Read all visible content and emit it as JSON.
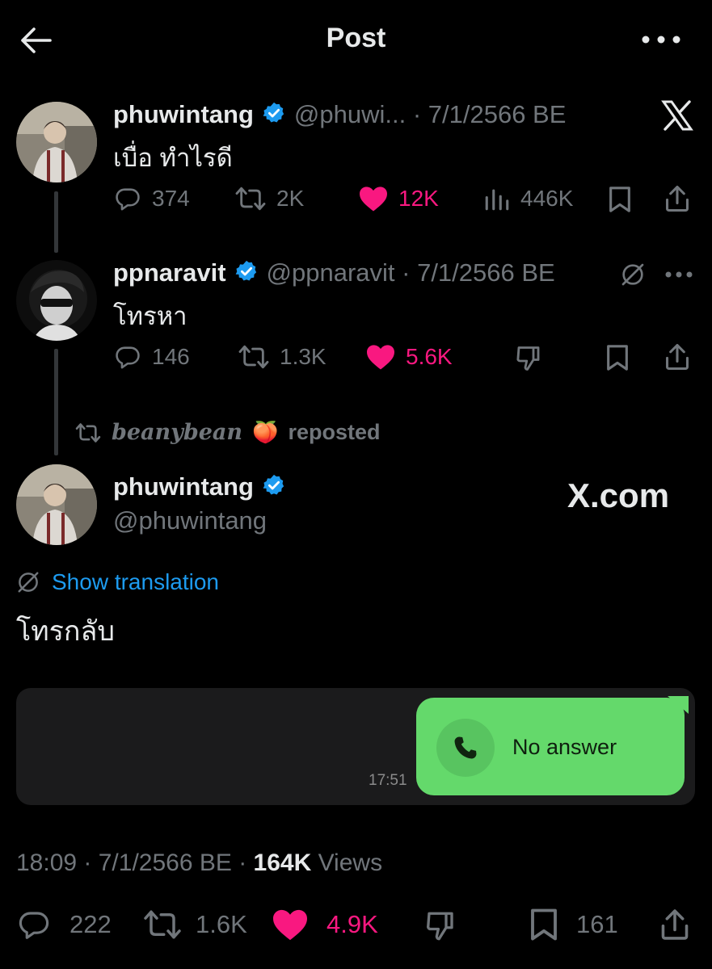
{
  "header": {
    "title": "Post"
  },
  "tweet1": {
    "name": "phuwintang",
    "handle_date": "@phuwi... · 7/1/2566 BE",
    "text": "เบื่อ ทำไรดี",
    "reply_count": "374",
    "retweet_count": "2K",
    "like_count": "12K",
    "view_count": "446K"
  },
  "tweet2": {
    "name": "ppnaravit",
    "handle_date": "@ppnaravit · 7/1/2566 BE",
    "text": "โทรหา",
    "reply_count": "146",
    "retweet_count": "1.3K",
    "like_count": "5.6K"
  },
  "repost": {
    "user": "beanybean",
    "emoji": "🍑",
    "label": "reposted"
  },
  "main_tweet": {
    "name": "phuwintang",
    "handle": "@phuwintang",
    "x_label": "X.com",
    "show_translation": "Show translation",
    "text": "โทรกลับ",
    "media": {
      "status": "No answer",
      "time": "17:51"
    },
    "time_date": "18:09 · 7/1/2566 BE · ",
    "views_count": "164K",
    "views_label": " Views",
    "reply_count": "222",
    "retweet_count": "1.6K",
    "like_count": "4.9K",
    "bookmark_count": "161"
  },
  "colors": {
    "like": "#f91880",
    "link": "#1d9bf0",
    "verified": "#1d9bf0",
    "bubble": "#64d96b"
  }
}
